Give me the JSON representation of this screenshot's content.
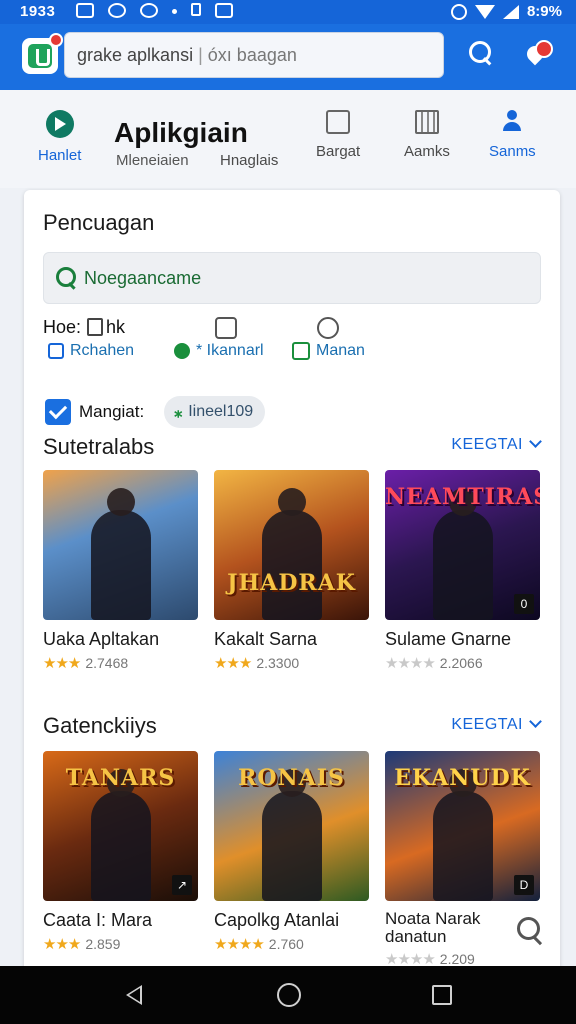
{
  "status_bar": {
    "time": "1933",
    "battery": "8:9%"
  },
  "appbar": {
    "search_value": "grake aplkansi",
    "search_suffix": "óxı baagan"
  },
  "topnav": {
    "home_label": "Hanlet",
    "title": "Aplikgiain",
    "sub_label": "Mleneiaien",
    "item2_label": "Hnaglais",
    "books_label": "Bargat",
    "apps_label": "Aamks",
    "account_label": "Sanms"
  },
  "card": {
    "title": "Pencuagan",
    "search_placeholder": "Noegaancame",
    "filters_label": "Hoe:",
    "filters_suffix": "hk",
    "chips": [
      "Rchahen",
      "* Ikannarl",
      "Manan"
    ],
    "checkbox_label": "Mangiat:",
    "pill_label": "Iineel109"
  },
  "sections": [
    {
      "title": "Sutetralabs",
      "link": "KEEGTAI",
      "games": [
        {
          "name": "Uaka Apltakan",
          "rating": "2.7468",
          "stars": "★★★",
          "logo": "",
          "corner": "",
          "theme": "t1"
        },
        {
          "name": "Kakalt Sarna",
          "rating": "2.3300",
          "stars": "★★★",
          "logo": "JHADRAK",
          "corner": "",
          "theme": "t2"
        },
        {
          "name": "Sulame Gnarne",
          "rating": "2.2066",
          "stars": "★★★★",
          "logo": "NEAMTIRAS",
          "corner": "0",
          "theme": "t3"
        }
      ]
    },
    {
      "title": "Gatenckiiys",
      "link": "KEEGTAI",
      "games": [
        {
          "name": "Caata I: Mara",
          "rating": "2.859",
          "stars": "★★★",
          "logo": "TANARS",
          "corner": "↗",
          "theme": "t4"
        },
        {
          "name": "Capolkg Atanlai",
          "rating": "2.760",
          "stars": "★★★★",
          "logo": "RONAIS",
          "corner": "",
          "theme": "t5"
        },
        {
          "name": "Noata Narak danatun",
          "rating": "2.209",
          "stars": "★★★★",
          "logo": "EKANUDK",
          "corner": "D",
          "theme": "t6"
        }
      ]
    }
  ],
  "colors": {
    "primary": "#1a6fe0",
    "accent_green": "#1a8f3c",
    "badge_red": "#e53935",
    "star": "#f0a81c"
  }
}
